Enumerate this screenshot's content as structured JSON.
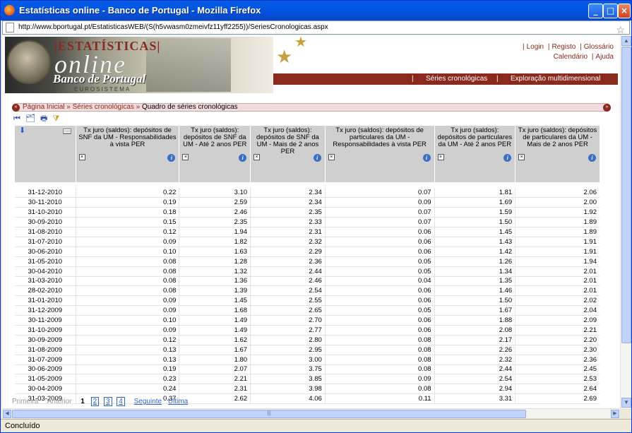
{
  "window": {
    "title": "Estatísticas online - Banco de Portugal - Mozilla Firefox"
  },
  "address": {
    "url": "http://www.bportugal.pt/EstatisticasWEB/(S(h5vwasm0zmeivfz11yff2255))/SeriesCronologicas.aspx"
  },
  "header": {
    "estatisticas": "|ESTATÍSTICAS|",
    "online": "online",
    "bank": "Banco de Portugal",
    "euro": "EUROSISTEMA",
    "links_top": [
      "Login",
      "Registo",
      "Glossário"
    ],
    "links_bottom": [
      "Calendário",
      "Ajuda"
    ],
    "nav": [
      "Séries cronológicas",
      "Exploração multidimensional"
    ]
  },
  "breadcrumb": [
    "Página Inicial",
    "Séries cronológicas",
    "Quadro de séries cronológicas"
  ],
  "table": {
    "columns": [
      "Tx juro (saldos): depósitos de SNF da UM - Responsabilidades à vista PER",
      "Tx juro (saldos): depósitos de SNF da UM - Até 2 anos PER",
      "Tx juro (saldos): depósitos de SNF da UM - Mais de 2 anos PER",
      "Tx juro (saldos): depósitos de particulares da UM - Responsabilidades à vista PER",
      "Tx juro (saldos): depósitos de particulares da UM - Até 2 anos PER",
      "Tx juro (saldos): depósitos de particulares da UM - Mais de 2 anos PER"
    ],
    "rows": [
      {
        "date": "31-12-2010",
        "v": [
          "0.22",
          "3.10",
          "2.34",
          "0.07",
          "1.81",
          "2.06"
        ]
      },
      {
        "date": "30-11-2010",
        "v": [
          "0.19",
          "2.59",
          "2.34",
          "0.09",
          "1.69",
          "2.00"
        ]
      },
      {
        "date": "31-10-2010",
        "v": [
          "0.18",
          "2.46",
          "2.35",
          "0.07",
          "1.59",
          "1.92"
        ]
      },
      {
        "date": "30-09-2010",
        "v": [
          "0.15",
          "2.35",
          "2.33",
          "0.07",
          "1.50",
          "1.89"
        ]
      },
      {
        "date": "31-08-2010",
        "v": [
          "0.12",
          "1.94",
          "2.31",
          "0.06",
          "1.45",
          "1.89"
        ]
      },
      {
        "date": "31-07-2010",
        "v": [
          "0.09",
          "1.82",
          "2.32",
          "0.06",
          "1.43",
          "1.91"
        ]
      },
      {
        "date": "30-06-2010",
        "v": [
          "0.10",
          "1.63",
          "2.29",
          "0.06",
          "1.42",
          "1.91"
        ]
      },
      {
        "date": "31-05-2010",
        "v": [
          "0.08",
          "1.28",
          "2.36",
          "0.05",
          "1.26",
          "1.94"
        ]
      },
      {
        "date": "30-04-2010",
        "v": [
          "0.08",
          "1.32",
          "2.44",
          "0.05",
          "1.34",
          "2.01"
        ]
      },
      {
        "date": "31-03-2010",
        "v": [
          "0.08",
          "1.36",
          "2.46",
          "0.04",
          "1.35",
          "2.01"
        ]
      },
      {
        "date": "28-02-2010",
        "v": [
          "0.08",
          "1.39",
          "2.54",
          "0.06",
          "1.46",
          "2.01"
        ]
      },
      {
        "date": "31-01-2010",
        "v": [
          "0.09",
          "1.45",
          "2.55",
          "0.06",
          "1.50",
          "2.02"
        ]
      },
      {
        "date": "31-12-2009",
        "v": [
          "0.09",
          "1.68",
          "2.65",
          "0.05",
          "1.67",
          "2.04"
        ]
      },
      {
        "date": "30-11-2009",
        "v": [
          "0.10",
          "1.49",
          "2.70",
          "0.06",
          "1.88",
          "2.09"
        ]
      },
      {
        "date": "31-10-2009",
        "v": [
          "0.09",
          "1.49",
          "2.77",
          "0.06",
          "2.08",
          "2.21"
        ]
      },
      {
        "date": "30-09-2009",
        "v": [
          "0.12",
          "1.62",
          "2.80",
          "0.08",
          "2.17",
          "2.20"
        ]
      },
      {
        "date": "31-08-2009",
        "v": [
          "0.13",
          "1.67",
          "2.95",
          "0.08",
          "2.26",
          "2.30"
        ]
      },
      {
        "date": "31-07-2009",
        "v": [
          "0.13",
          "1.80",
          "3.00",
          "0.08",
          "2.32",
          "2.36"
        ]
      },
      {
        "date": "30-06-2009",
        "v": [
          "0.19",
          "2.07",
          "3.75",
          "0.08",
          "2.44",
          "2.45"
        ]
      },
      {
        "date": "31-05-2009",
        "v": [
          "0.23",
          "2.21",
          "3.85",
          "0.09",
          "2.54",
          "2.53"
        ]
      },
      {
        "date": "30-04-2009",
        "v": [
          "0.24",
          "2.31",
          "3.98",
          "0.08",
          "2.94",
          "2.64"
        ]
      },
      {
        "date": "31-03-2009",
        "v": [
          "0.37",
          "2.62",
          "4.06",
          "0.11",
          "3.31",
          "2.69"
        ]
      }
    ]
  },
  "pager": {
    "first": "Primeira",
    "prev": "Anterior",
    "current": "1",
    "pages": [
      "2",
      "3",
      "4"
    ],
    "next": "Seguinte",
    "last": "Ultima"
  },
  "status": "Concluído"
}
